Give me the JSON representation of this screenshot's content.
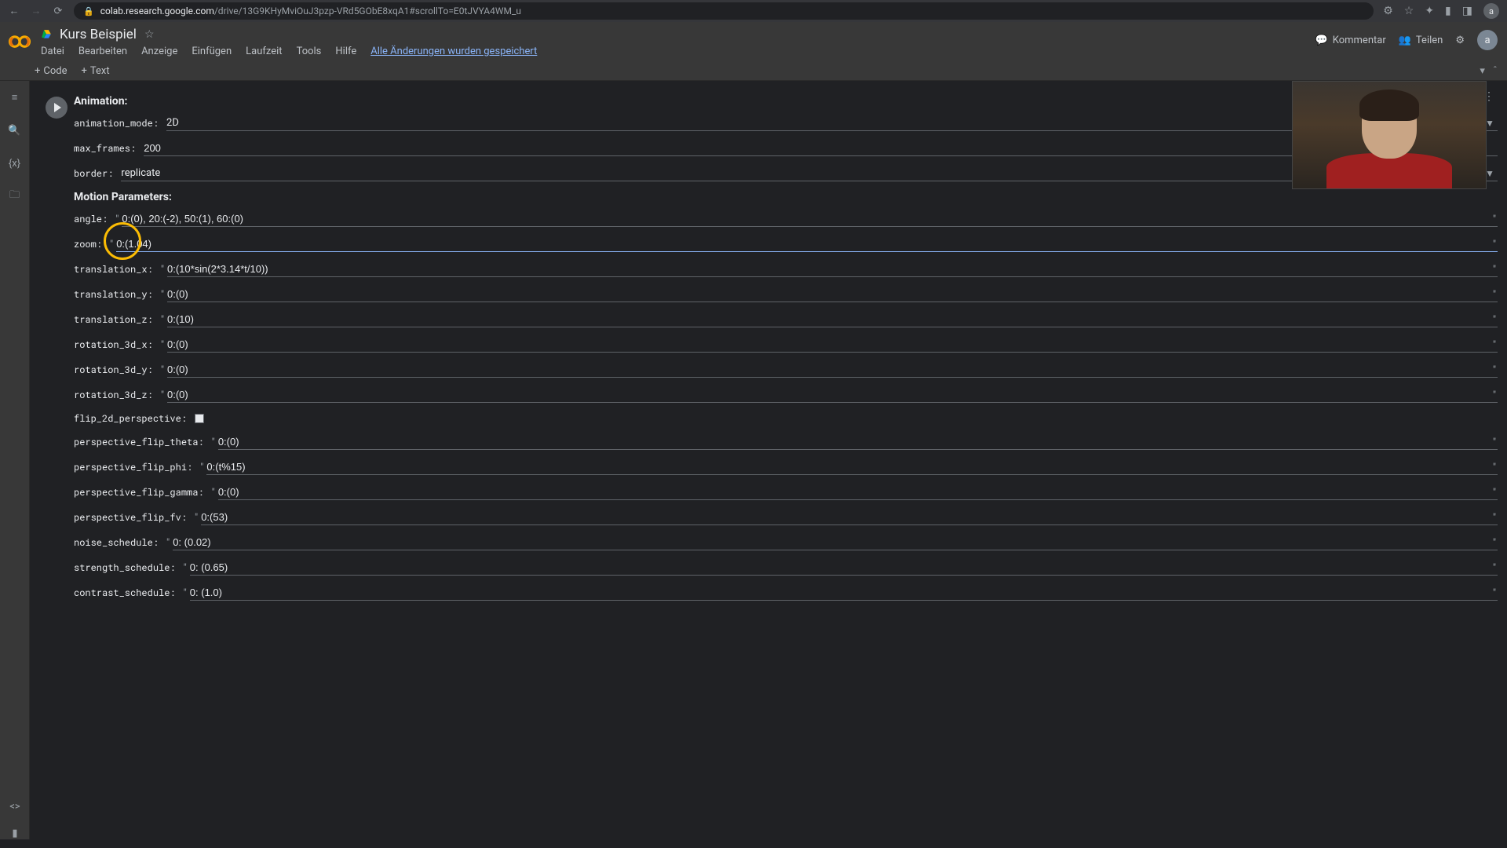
{
  "browser": {
    "url_prefix": "colab.research.google.com",
    "url_path": "/drive/13G9KHyMviOuJ3pzp-VRd5GObE8xqA1#scrollTo=E0tJVYA4WM_u"
  },
  "header": {
    "title": "Kurs Beispiel",
    "menus": [
      "Datei",
      "Bearbeiten",
      "Anzeige",
      "Einfügen",
      "Laufzeit",
      "Tools",
      "Hilfe"
    ],
    "saved": "Alle Änderungen wurden gespeichert",
    "comment": "Kommentar",
    "share": "Teilen",
    "avatar": "a"
  },
  "toolbar": {
    "code": "Code",
    "text": "Text"
  },
  "sections": {
    "animation": "Animation:",
    "motion": "Motion Parameters:"
  },
  "fields": {
    "animation_mode": {
      "label": "animation_mode:",
      "value": "2D"
    },
    "max_frames": {
      "label": "max_frames:",
      "value": "200"
    },
    "border": {
      "label": "border:",
      "value": "replicate"
    },
    "angle": {
      "label": "angle:",
      "value": "0:(0), 20:(-2), 50:(1), 60:(0)"
    },
    "zoom": {
      "label": "zoom:",
      "value": "0:(1.04)"
    },
    "translation_x": {
      "label": "translation_x:",
      "value": "0:(10*sin(2*3.14*t/10))"
    },
    "translation_y": {
      "label": "translation_y:",
      "value": "0:(0)"
    },
    "translation_z": {
      "label": "translation_z:",
      "value": "0:(10)"
    },
    "rotation_3d_x": {
      "label": "rotation_3d_x:",
      "value": "0:(0)"
    },
    "rotation_3d_y": {
      "label": "rotation_3d_y:",
      "value": "0:(0)"
    },
    "rotation_3d_z": {
      "label": "rotation_3d_z:",
      "value": "0:(0)"
    },
    "flip_2d_perspective": {
      "label": "flip_2d_perspective:"
    },
    "perspective_flip_theta": {
      "label": "perspective_flip_theta:",
      "value": "0:(0)"
    },
    "perspective_flip_phi": {
      "label": "perspective_flip_phi:",
      "value": "0:(t%15)"
    },
    "perspective_flip_gamma": {
      "label": "perspective_flip_gamma:",
      "value": "0:(0)"
    },
    "perspective_flip_fv": {
      "label": "perspective_flip_fv:",
      "value": "0:(53)"
    },
    "noise_schedule": {
      "label": "noise_schedule:",
      "value": "0: (0.02)"
    },
    "strength_schedule": {
      "label": "strength_schedule:",
      "value": "0: (0.65)"
    },
    "contrast_schedule": {
      "label": "contrast_schedule:",
      "value": "0: (1.0)"
    }
  }
}
